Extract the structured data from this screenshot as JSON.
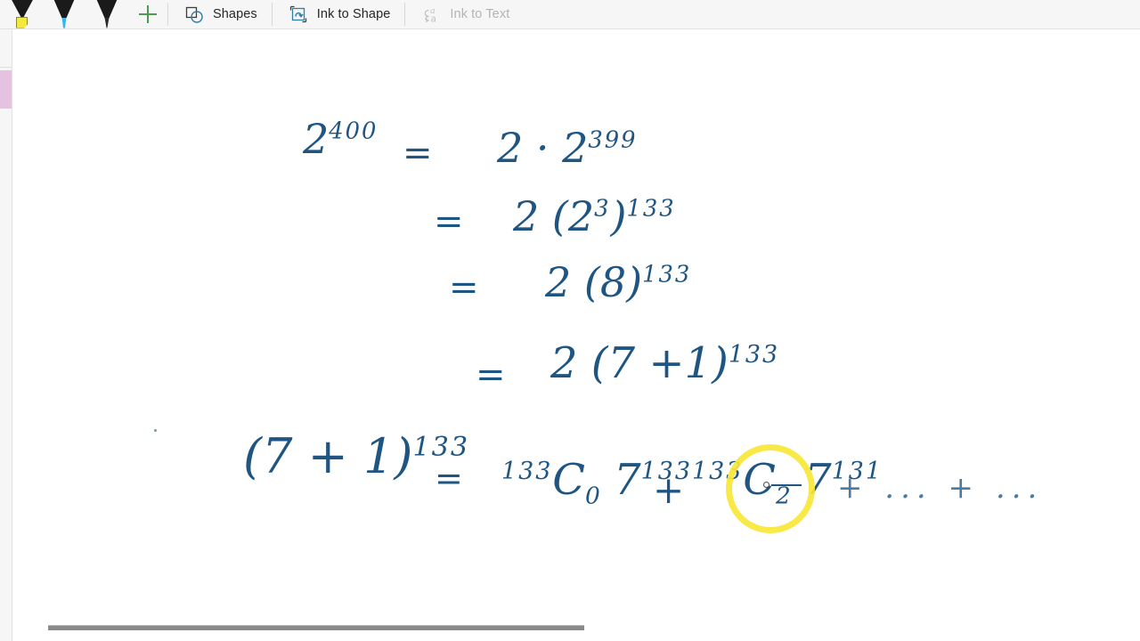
{
  "toolbar": {
    "pens": [
      {
        "name": "highlighter-yellow",
        "label": "Yellow Highlighter",
        "color": "#f2e93c"
      },
      {
        "name": "pen-blue",
        "label": "Blue Pen",
        "color": "#37b6e9"
      },
      {
        "name": "pen-black",
        "label": "Black Pen",
        "color": "#2b2b2b"
      }
    ],
    "add_pen_label": "+",
    "shapes_label": "Shapes",
    "ink_to_shape_label": "Ink to Shape",
    "ink_to_text_label": "Ink to Text",
    "ink_to_text_enabled": false,
    "background": "#f6f6f6",
    "text_color": "#262626",
    "disabled_text_color": "#b4b4b4",
    "accent_green": "#4f9a52",
    "accent_blue": "#2f7fa8"
  },
  "sidebar": {
    "active_tab_color": "#e5c2e0",
    "background": "#f6f6f6"
  },
  "canvas": {
    "ink_color": "#1f5582",
    "highlight_color": "#f9e737",
    "background": "#ffffff",
    "lines": [
      {
        "id": "line-1",
        "left_expr": "2",
        "left_exp": "400",
        "relation": "=",
        "right": "2 · 2",
        "right_exp": "399"
      },
      {
        "id": "line-2",
        "relation": "=",
        "body": "2 (2",
        "inner_exp": "3",
        "close": ")",
        "outer_exp": "133"
      },
      {
        "id": "line-3",
        "relation": "=",
        "body": "2 (8)",
        "outer_exp": "133"
      },
      {
        "id": "line-4",
        "relation": "=",
        "body": "2 (7 +1)",
        "outer_exp": "133"
      }
    ],
    "expansion": {
      "lhs_base": "(7 + 1)",
      "lhs_exp": "133",
      "relation": "=",
      "term1_pre": "133",
      "term1_c": "C",
      "term1_sub": "0",
      "term1_base": "7",
      "term1_exp": "133",
      "operator": "+",
      "term2_pre": "133",
      "term2_c": "C",
      "term2_sub": "2",
      "term2_base": "7",
      "term2_exp": "131",
      "trailing": "+ ... + ...",
      "trailing_marks": [
        "+",
        "--",
        "-",
        "··",
        "+"
      ]
    },
    "highlight_annotation": {
      "name": "yellow-circle-highlight",
      "encircles": "133C2 7"
    }
  },
  "scrollbar": {
    "orientation": "horizontal",
    "thumb_color": "#8a8a8a"
  }
}
